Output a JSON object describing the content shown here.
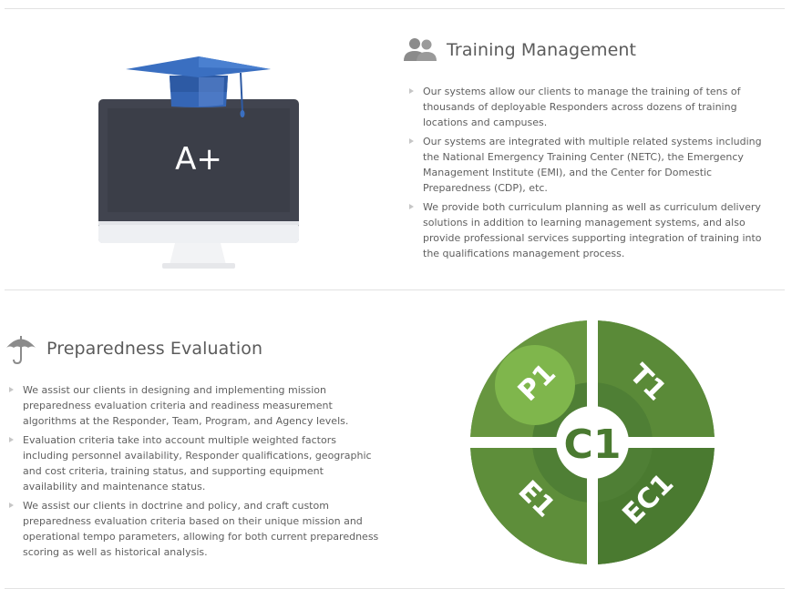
{
  "training": {
    "title": "Training Management",
    "icon": "users-icon",
    "screen_text": "A+",
    "bullets": [
      "Our systems allow our clients to manage the training of tens of thousands of deployable Responders across dozens of training locations and campuses.",
      "Our systems are integrated with multiple related systems including the National Emergency Training Center (NETC), the Emergency Management Institute (EMI), and the Center for Domestic Preparedness (CDP), etc.",
      "We provide both curriculum planning as well as curriculum delivery solutions in addition to learning management systems, and also provide professional services supporting integration of training into the qualifications management process."
    ]
  },
  "preparedness": {
    "title": "Preparedness Evaluation",
    "icon": "umbrella-icon",
    "bullets": [
      "We assist our clients in designing and implementing mission preparedness evaluation criteria and readiness measurement algorithms at the Responder, Team, Program, and Agency levels.",
      "Evaluation criteria take into account multiple weighted factors including personnel availability, Responder qualifications, geographic and cost criteria, training status, and supporting equipment availability and maintenance status.",
      "We assist our clients in doctrine and policy, and craft custom preparedness evaluation criteria based on their unique mission and operational tempo parameters, allowing for both current preparedness scoring as well as historical analysis."
    ]
  },
  "wheel": {
    "center": "C1",
    "quadrants": {
      "top_left": "P1",
      "top_right": "T1",
      "bottom_left": "E1",
      "bottom_right": "EC1"
    }
  },
  "colors": {
    "monitor_frame": "#41444f",
    "cap_blue": "#3a6fc1",
    "green_dark": "#4e7d34",
    "green_mid": "#66953f",
    "green_light": "#7fb64c",
    "text": "#5f5f5f"
  }
}
